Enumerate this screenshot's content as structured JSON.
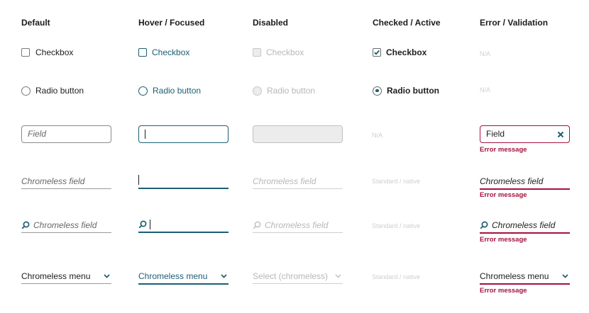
{
  "headers": {
    "default": "Default",
    "hover": "Hover / Focused",
    "disabled": "Disabled",
    "checked": "Checked / Active",
    "error": "Error / Validation"
  },
  "checkbox": {
    "default": "Checkbox",
    "hover": "Checkbox",
    "disabled": "Checkbox",
    "checked": "Checkbox",
    "error": "N/A"
  },
  "radio": {
    "default": "Radio button",
    "hover": "Radio button",
    "disabled": "Radio button",
    "checked": "Radio button",
    "error": "N/A"
  },
  "field": {
    "default_placeholder": "Field",
    "checked": "N/A",
    "error_value": "Field",
    "error_message": "Error message"
  },
  "chromeless_field": {
    "default_placeholder": "Chromeless field",
    "disabled_placeholder": "Chromeless field",
    "checked": "Standard / native",
    "error_value": "Chromeless field",
    "error_message": "Error message"
  },
  "search_field": {
    "default_placeholder": "Chromeless field",
    "disabled_placeholder": "Chromeless field",
    "checked": "Standard / native",
    "error_value": "Chromeless field",
    "error_message": "Error message"
  },
  "menu": {
    "default": "Chromeless menu",
    "hover": "Chromeless menu",
    "disabled": "Select (chromeless)",
    "checked": "Standard / native",
    "error": "Chromeless menu",
    "error_message": "Error message"
  },
  "colors": {
    "focus": "#1c5e73",
    "error": "#a4123e",
    "disabled": "#b7b7b7"
  }
}
